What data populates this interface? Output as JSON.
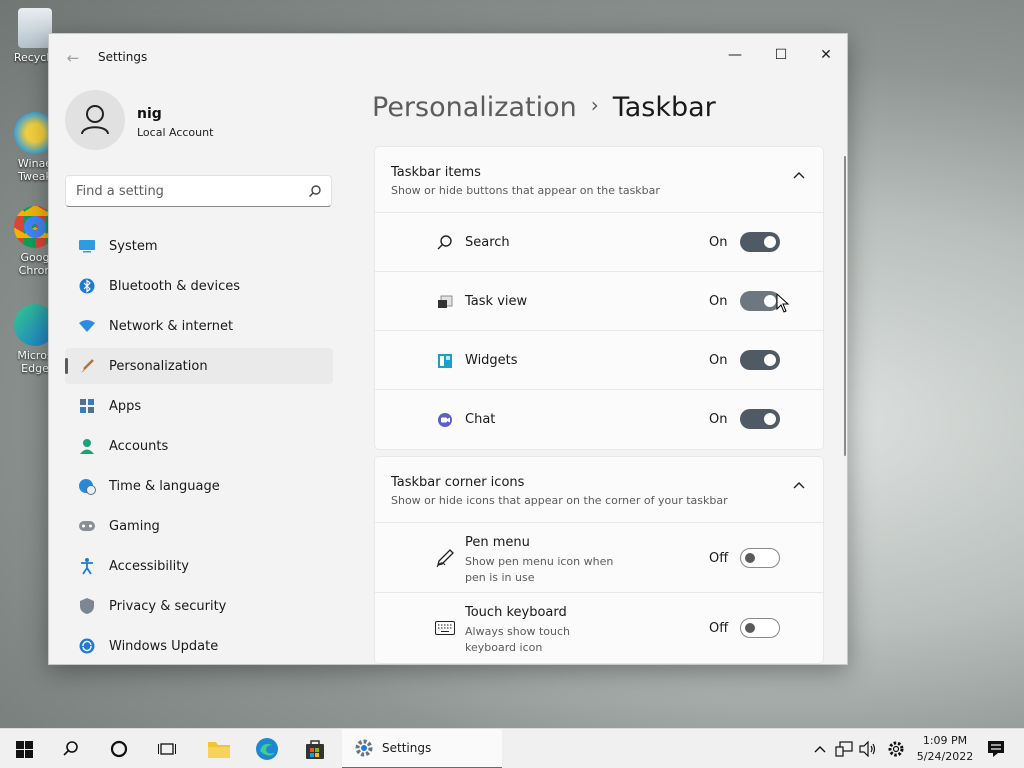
{
  "desktop": {
    "icons": [
      {
        "label": "Recycle",
        "icon": "recycle-bin-icon"
      },
      {
        "label": "Winae Tweak",
        "icon": "winaero-tweaker-icon"
      },
      {
        "label": "Goog Chron",
        "icon": "chrome-icon"
      },
      {
        "label": "Micros Edge",
        "icon": "edge-icon"
      }
    ]
  },
  "window": {
    "title": "Settings",
    "controls": {
      "minimize": "—",
      "maximize": "☐",
      "close": "✕"
    }
  },
  "profile": {
    "name": "nig",
    "account_type": "Local Account"
  },
  "search": {
    "placeholder": "Find a setting"
  },
  "nav": [
    {
      "label": "System",
      "icon": "system-icon",
      "active": false
    },
    {
      "label": "Bluetooth & devices",
      "icon": "bluetooth-icon",
      "active": false
    },
    {
      "label": "Network & internet",
      "icon": "wifi-icon",
      "active": false
    },
    {
      "label": "Personalization",
      "icon": "brush-icon",
      "active": true
    },
    {
      "label": "Apps",
      "icon": "apps-icon",
      "active": false
    },
    {
      "label": "Accounts",
      "icon": "accounts-icon",
      "active": false
    },
    {
      "label": "Time & language",
      "icon": "globe-clock-icon",
      "active": false
    },
    {
      "label": "Gaming",
      "icon": "gamepad-icon",
      "active": false
    },
    {
      "label": "Accessibility",
      "icon": "accessibility-icon",
      "active": false
    },
    {
      "label": "Privacy & security",
      "icon": "shield-icon",
      "active": false
    },
    {
      "label": "Windows Update",
      "icon": "update-icon",
      "active": false
    }
  ],
  "breadcrumb": {
    "parent": "Personalization",
    "separator": "›",
    "current": "Taskbar"
  },
  "groups": {
    "taskbar_items": {
      "title": "Taskbar items",
      "subtitle": "Show or hide buttons that appear on the taskbar",
      "rows": [
        {
          "label": "Search",
          "state": "On",
          "icon": "search-icon"
        },
        {
          "label": "Task view",
          "state": "On",
          "icon": "task-view-icon"
        },
        {
          "label": "Widgets",
          "state": "On",
          "icon": "widgets-icon"
        },
        {
          "label": "Chat",
          "state": "On",
          "icon": "chat-icon"
        }
      ]
    },
    "corner_icons": {
      "title": "Taskbar corner icons",
      "subtitle": "Show or hide icons that appear on the corner of your taskbar",
      "rows": [
        {
          "label": "Pen menu",
          "description": "Show pen menu icon when pen is in use",
          "state": "Off",
          "icon": "pen-icon"
        },
        {
          "label": "Touch keyboard",
          "description": "Always show touch keyboard icon",
          "state": "Off",
          "icon": "keyboard-icon"
        }
      ]
    }
  },
  "taskbar": {
    "active_app_label": "Settings",
    "time": "1:09 PM",
    "date": "5/24/2022"
  },
  "colors": {
    "toggle_on": "#4f5a65",
    "accent": "#1e7bd9",
    "window_bg": "#f3f3f3"
  }
}
